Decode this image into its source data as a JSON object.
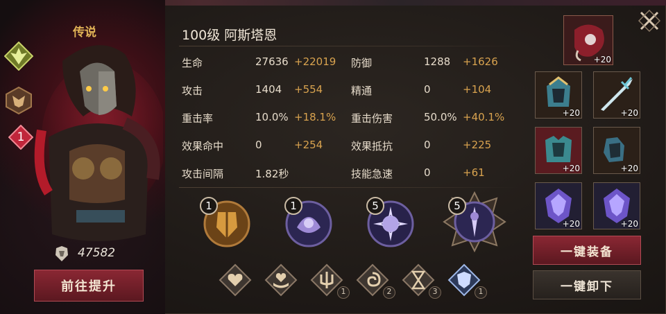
{
  "hero": {
    "rarity": "传说",
    "star_badge": "1",
    "power": "47582",
    "upgrade_button": "前往提升"
  },
  "title": {
    "level_name": "100级  阿斯塔恩"
  },
  "stats": [
    {
      "label": "生命",
      "value": "27636",
      "bonus": "+22019"
    },
    {
      "label": "防御",
      "value": "1288",
      "bonus": "+1626"
    },
    {
      "label": "攻击",
      "value": "1404",
      "bonus": "+554"
    },
    {
      "label": "精通",
      "value": "0",
      "bonus": "+104"
    },
    {
      "label": "重击率",
      "value": "10.0%",
      "bonus": "+18.1%"
    },
    {
      "label": "重击伤害",
      "value": "50.0%",
      "bonus": "+40.1%"
    },
    {
      "label": "效果命中",
      "value": "0",
      "bonus": "+254"
    },
    {
      "label": "效果抵抗",
      "value": "0",
      "bonus": "+225"
    },
    {
      "label": "攻击间隔",
      "value": "1.82秒",
      "bonus": ""
    },
    {
      "label": "技能急速",
      "value": "0",
      "bonus": "+61"
    }
  ],
  "skills": [
    {
      "level": "1"
    },
    {
      "level": "1"
    },
    {
      "level": "5"
    },
    {
      "level": "5"
    }
  ],
  "buffs": [
    {
      "icon": "heart-icon",
      "count": ""
    },
    {
      "icon": "heart-hand-icon",
      "count": ""
    },
    {
      "icon": "trident-icon",
      "count": "1"
    },
    {
      "icon": "swirl-icon",
      "count": "2"
    },
    {
      "icon": "hourglass-icon",
      "count": "3"
    },
    {
      "icon": "crest-icon",
      "count": "1"
    }
  ],
  "equipment": [
    {
      "slot": "artifact",
      "level": "+20"
    },
    {
      "slot": "helmet",
      "level": "+20"
    },
    {
      "slot": "weapon",
      "level": "+20"
    },
    {
      "slot": "armor",
      "level": "+20"
    },
    {
      "slot": "gloves",
      "level": "+20"
    },
    {
      "slot": "crystal-1",
      "level": "+20"
    },
    {
      "slot": "crystal-2",
      "level": "+20"
    }
  ],
  "actions": {
    "equip_all": "一键装备",
    "unequip_all": "一键卸下"
  },
  "colors": {
    "gold": "#e1b356",
    "bonus": "#d9a34f",
    "red_button": "#8a2733"
  }
}
